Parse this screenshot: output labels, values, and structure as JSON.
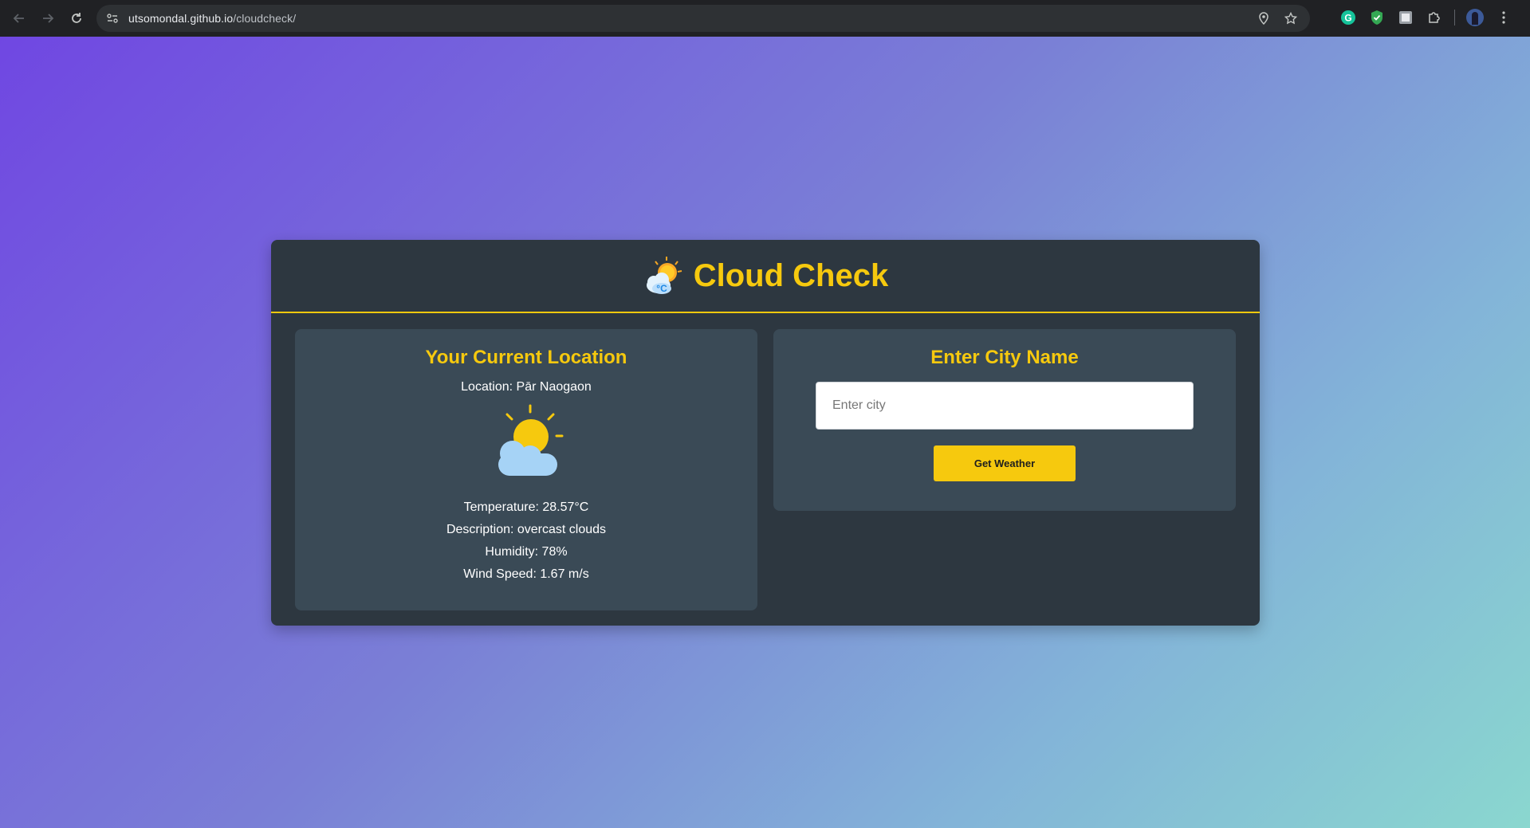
{
  "browser": {
    "url_host": "utsomondal.github.io",
    "url_path": "/cloudcheck/",
    "icons": [
      "back-arrow-icon",
      "forward-arrow-icon",
      "reload-icon",
      "site-info-icon",
      "location-pin-icon",
      "bookmark-star-icon",
      "grammarly-icon",
      "shield-extension-icon",
      "photo-extension-icon",
      "extensions-puzzle-icon",
      "profile-avatar",
      "kebab-menu-icon"
    ]
  },
  "header": {
    "title": "Cloud Check",
    "logo_icon": "sun-behind-cloud-icon"
  },
  "current_location": {
    "heading": "Your Current Location",
    "location": "Location: Pār Naogaon",
    "weather_icon": "partly-cloudy-icon",
    "temperature": "Temperature: 28.57°C",
    "description": "Description: overcast clouds",
    "humidity": "Humidity: 78%",
    "wind": "Wind Speed: 1.67 m/s"
  },
  "city_search": {
    "heading": "Enter City Name",
    "input_placeholder": "Enter city",
    "input_value": "",
    "button_label": "Get Weather"
  },
  "colors": {
    "accent": "#f6c90e",
    "panel": "#2d3740",
    "card": "#3a4a56",
    "gradient_start": "#7047e2",
    "gradient_end": "#8ad7cf"
  }
}
